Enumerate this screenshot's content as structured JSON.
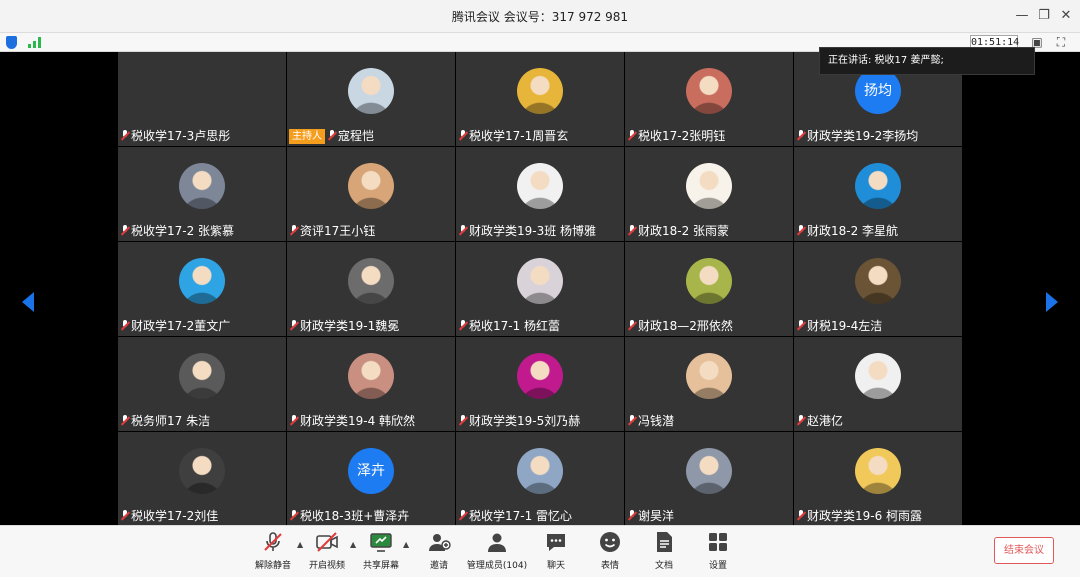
{
  "window": {
    "title": "腾讯会议  会议号：317 972 981"
  },
  "status": {
    "timer": "01:51:14"
  },
  "speaker": {
    "text": "正在讲话: 税收17 姜严懿;"
  },
  "participants": [
    {
      "name": "税收学17-3卢思彤",
      "avatar": "none"
    },
    {
      "name": "寇程恺",
      "host": "主持人",
      "avatar": "photo",
      "color": "#c9d7e3"
    },
    {
      "name": "税收学17-1周晋玄",
      "avatar": "photo",
      "color": "#e6b53a"
    },
    {
      "name": "税收17-2张明钰",
      "avatar": "photo",
      "color": "#c96d5f"
    },
    {
      "name": "财政学类19-2李扬均",
      "avatar": "text",
      "avatar_text": "扬均"
    },
    {
      "name": "税收学17-2 张紫慕",
      "avatar": "photo",
      "color": "#7d8798"
    },
    {
      "name": "资评17王小钰",
      "avatar": "photo",
      "color": "#d7a577"
    },
    {
      "name": "财政学类19-3班 杨博雅",
      "avatar": "photo",
      "color": "#f1f1f1"
    },
    {
      "name": "财政18-2 张雨蒙",
      "avatar": "photo",
      "color": "#f7f3ea"
    },
    {
      "name": "财政18-2 李星航",
      "avatar": "photo",
      "color": "#1f8dd8"
    },
    {
      "name": "财政学17-2董文广",
      "avatar": "photo",
      "color": "#2ea4e5"
    },
    {
      "name": "财政学类19-1魏冕",
      "avatar": "photo",
      "color": "#6c6c6c"
    },
    {
      "name": "税收17-1 杨红蕾",
      "avatar": "photo",
      "color": "#d9d3d9"
    },
    {
      "name": "财政18—2邢依然",
      "avatar": "photo",
      "color": "#a8b54a"
    },
    {
      "name": "财税19-4左洁",
      "avatar": "photo",
      "color": "#6b5436"
    },
    {
      "name": "税务师17 朱洁",
      "avatar": "photo",
      "color": "#5a5a5a"
    },
    {
      "name": "财政学类19-4 韩欣然",
      "avatar": "photo",
      "color": "#c98f80"
    },
    {
      "name": "财政学类19-5刘乃赫",
      "avatar": "photo",
      "color": "#c01a8e"
    },
    {
      "name": "冯钱潜",
      "avatar": "photo",
      "color": "#e5c09a"
    },
    {
      "name": "赵港亿",
      "avatar": "photo",
      "color": "#f0f0f0"
    },
    {
      "name": "税收学17-2刘佳",
      "avatar": "photo",
      "color": "#3f3f3f"
    },
    {
      "name": "税收18-3班+曹泽卉",
      "avatar": "text",
      "avatar_text": "泽卉"
    },
    {
      "name": "税收学17-1 雷忆心",
      "avatar": "photo",
      "color": "#8fa7c4"
    },
    {
      "name": "谢昊洋",
      "avatar": "photo",
      "color": "#8e98a8"
    },
    {
      "name": "财政学类19-6 柯雨露",
      "avatar": "photo",
      "color": "#f1c95b"
    }
  ],
  "toolbar": {
    "mute": "解除静音",
    "video": "开启视频",
    "share": "共享屏幕",
    "invite": "邀请",
    "members": "管理成员(104)",
    "chat": "聊天",
    "emoji": "表情",
    "docs": "文档",
    "settings": "设置",
    "end": "结束会议"
  },
  "colors": {
    "accent": "#1a73e8",
    "host_badge": "#f59d1c",
    "end": "#e15a5a",
    "tile_bg": "#343434"
  }
}
